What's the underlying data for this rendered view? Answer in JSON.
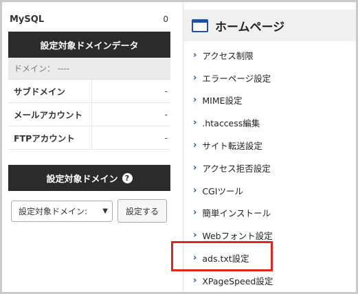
{
  "summary": {
    "mysql_label": "MySQL",
    "mysql_value": "0"
  },
  "domain_data": {
    "header": "設定対象ドメインデータ",
    "domain_line": "ドメイン： ----",
    "rows": [
      {
        "label": "サブドメイン",
        "value": "-"
      },
      {
        "label": "メールアカウント",
        "value": "-"
      },
      {
        "label": "FTPアカウント",
        "value": "-"
      }
    ]
  },
  "domain_select": {
    "header": "設定対象ドメイン",
    "help_icon": "question-circle-icon",
    "selected_value": "設定対象ドメイン:",
    "submit_label": "設定する"
  },
  "homepage": {
    "title": "ホームページ",
    "items": [
      {
        "label": "アクセス制限"
      },
      {
        "label": "エラーページ設定"
      },
      {
        "label": "MIME設定"
      },
      {
        "label": ".htaccess編集"
      },
      {
        "label": "サイト転送設定"
      },
      {
        "label": "アクセス拒否設定"
      },
      {
        "label": "CGIツール"
      },
      {
        "label": "簡単インストール"
      },
      {
        "label": "Webフォント設定"
      },
      {
        "label": "ads.txt設定"
      },
      {
        "label": "XPageSpeed設定"
      }
    ]
  },
  "colors": {
    "dark_header": "#2b2b2b",
    "arrow": "#1f4fa0",
    "highlight": "#e0261c"
  }
}
